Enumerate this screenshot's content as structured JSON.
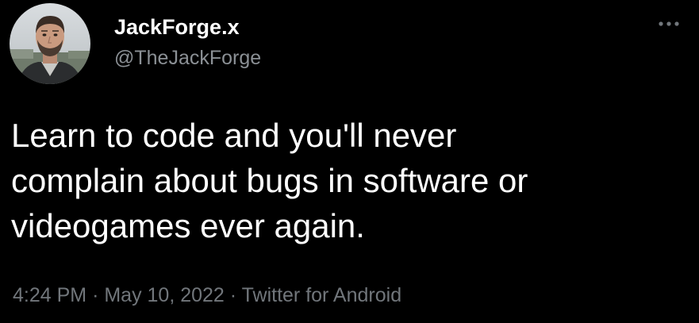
{
  "author": {
    "display_name": "JackForge.x",
    "handle": "@TheJackForge"
  },
  "icons": {
    "avatar": "profile-photo",
    "more": "more-horizontal-icon"
  },
  "tweet": {
    "text": "Learn to code and you'll never\ncomplain about bugs in software or\nvideogames ever again."
  },
  "meta": {
    "time": "4:24 PM",
    "separator": "·",
    "date": "May 10, 2022",
    "source": "Twitter for Android"
  },
  "colors": {
    "background": "#000000",
    "primary_text": "#ffffff",
    "secondary_text": "#71767b"
  }
}
